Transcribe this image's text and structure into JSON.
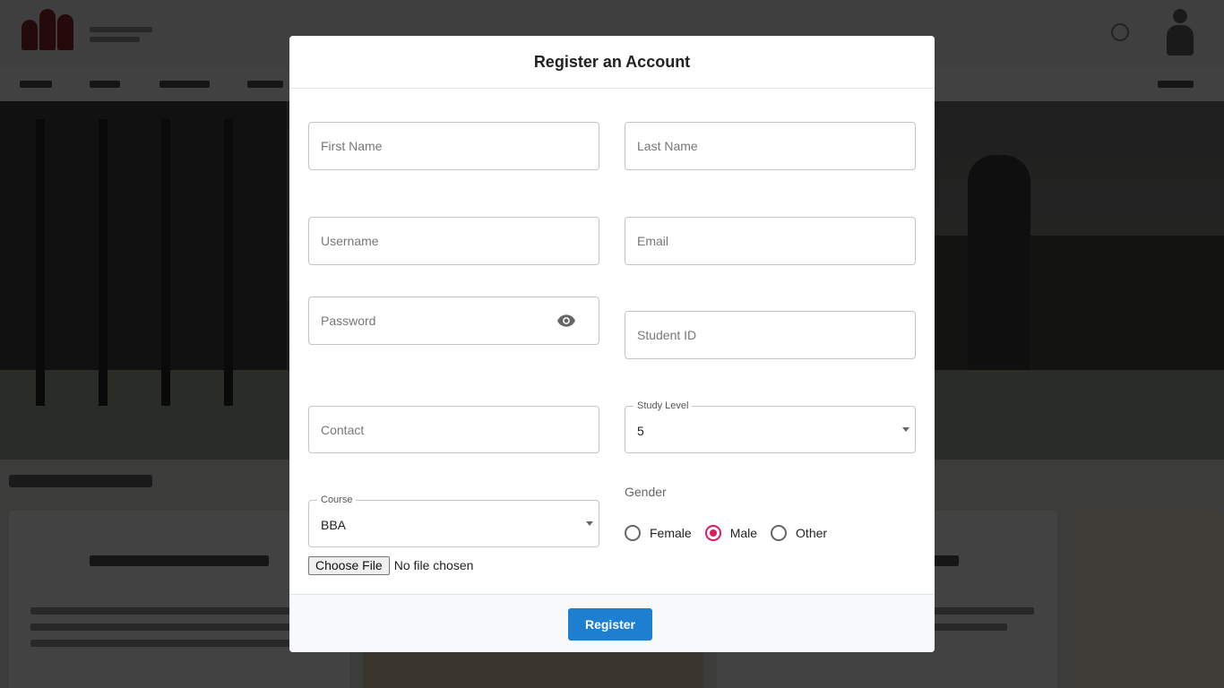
{
  "modal": {
    "title": "Register an Account",
    "fields": {
      "first_name": {
        "placeholder": "First Name",
        "value": ""
      },
      "last_name": {
        "placeholder": "Last Name",
        "value": ""
      },
      "username": {
        "placeholder": "Username",
        "value": ""
      },
      "email": {
        "placeholder": "Email",
        "value": ""
      },
      "password": {
        "placeholder": "Password",
        "value": ""
      },
      "student_id": {
        "placeholder": "Student ID",
        "value": ""
      },
      "contact": {
        "placeholder": "Contact",
        "value": ""
      }
    },
    "study_level": {
      "label": "Study Level",
      "value": "5"
    },
    "course": {
      "label": "Course",
      "value": "BBA"
    },
    "file_upload": {
      "button_label": "Choose File",
      "status": "No file chosen"
    },
    "gender": {
      "label": "Gender",
      "options": [
        {
          "label": "Female",
          "checked": false
        },
        {
          "label": "Male",
          "checked": true
        },
        {
          "label": "Other",
          "checked": false
        }
      ]
    },
    "register_label": "Register"
  },
  "icons": {
    "password_toggle": "eye-icon"
  },
  "colors": {
    "accent": "#1e7fd0",
    "radio_checked": "#e0195c"
  }
}
